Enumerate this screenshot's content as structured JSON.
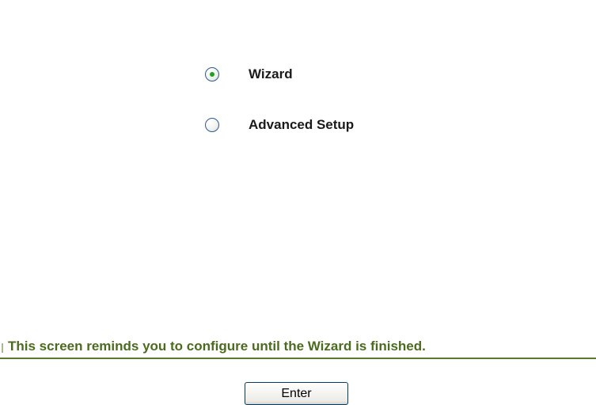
{
  "options": {
    "selected": "Wizard",
    "items": [
      {
        "label": "Wizard",
        "checked": true
      },
      {
        "label": "Advanced Setup",
        "checked": false
      }
    ]
  },
  "reminder": {
    "text": "This screen reminds you to configure until the Wizard is finished."
  },
  "actions": {
    "enter_label": "Enter"
  },
  "colors": {
    "reminder_text": "#4b6b1e",
    "divider": "#5b7a2a",
    "radio_dot": "#21a121",
    "radio_border": "#2d5a9a"
  }
}
